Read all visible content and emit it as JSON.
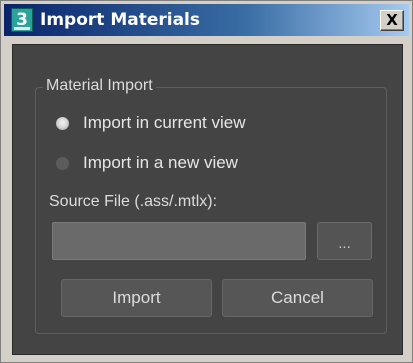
{
  "window": {
    "title": "Import Materials",
    "app_icon_label": "3",
    "close_label": "X"
  },
  "group": {
    "label": "Material Import"
  },
  "options": [
    {
      "label": "Import in current view",
      "selected": true
    },
    {
      "label": "Import in a new view",
      "selected": false
    }
  ],
  "source": {
    "label": "Source File (.ass/.mtlx):",
    "value": "",
    "browse_label": "..."
  },
  "actions": {
    "import_label": "Import",
    "cancel_label": "Cancel"
  },
  "colors": {
    "client_bg": "#444444",
    "titlebar_start": "#0a246a",
    "titlebar_end": "#a6caf0"
  }
}
